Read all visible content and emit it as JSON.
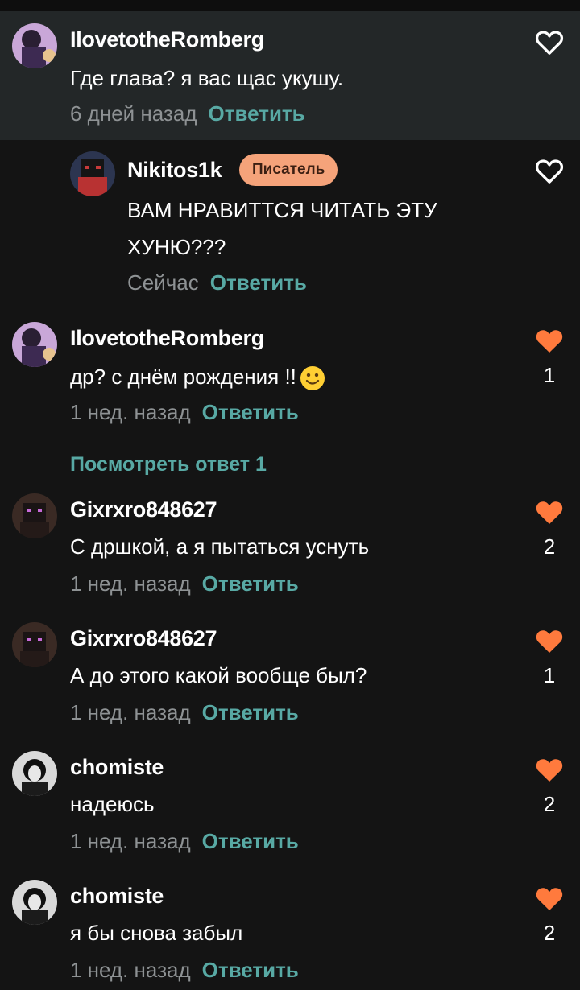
{
  "comments": [
    {
      "user": "IlovetotheRomberg",
      "text": "Где глава? я вас щас укушу.",
      "time": "6 дней назад",
      "reply": "Ответить",
      "likes": ""
    },
    {
      "user": "Nikitos1k",
      "badge": "Писатель",
      "text": "ВАМ НРАВИТТСЯ ЧИТАТЬ ЭТУ ХУНЮ???",
      "time": "Сейчас",
      "reply": "Ответить",
      "likes": ""
    },
    {
      "user": "IlovetotheRomberg",
      "text": "др? с днём рождения !!",
      "time": "1 нед. назад",
      "reply": "Ответить",
      "likes": "1"
    },
    {
      "user": "Gixrxro848627",
      "text": "С дршкой, а я пытаться уснуть",
      "time": "1 нед. назад",
      "reply": "Ответить",
      "likes": "2"
    },
    {
      "user": "Gixrxro848627",
      "text": "А до этого какой вообще был?",
      "time": "1 нед. назад",
      "reply": "Ответить",
      "likes": "1"
    },
    {
      "user": "chomiste",
      "text": "надеюсь",
      "time": "1 нед. назад",
      "reply": "Ответить",
      "likes": "2"
    },
    {
      "user": "chomiste",
      "text": "я бы снова забыл",
      "time": "1 нед. назад",
      "reply": "Ответить",
      "likes": "2"
    }
  ],
  "view_replies": "Посмотреть ответ 1",
  "colors": {
    "accent": "#58a9a4",
    "like": "#ff7a3d",
    "badge": "#f5a37a",
    "highlight": "#232728"
  }
}
